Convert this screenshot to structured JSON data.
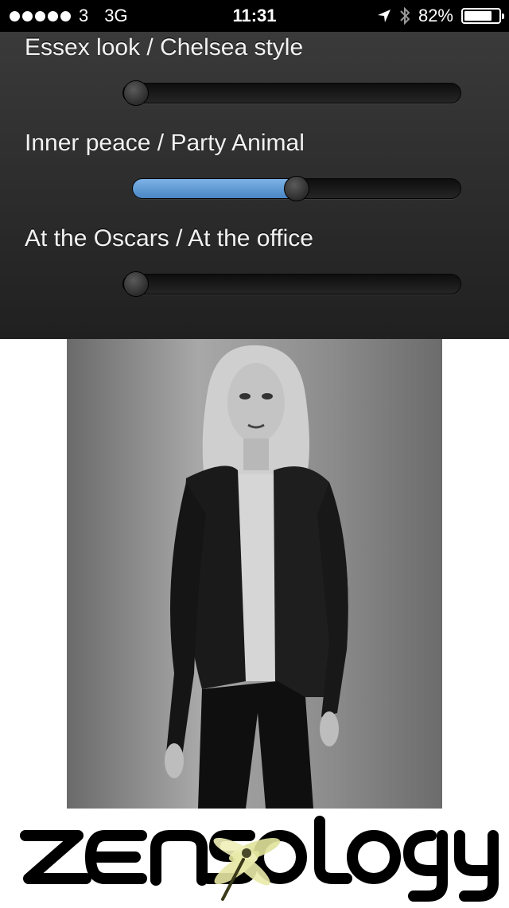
{
  "status_bar": {
    "carrier": "3",
    "network": "3G",
    "time": "11:31",
    "battery_percent": "82%",
    "battery_level": 0.82,
    "signal_dots": 5,
    "icons": [
      "location-arrow-icon",
      "bluetooth-icon",
      "battery-icon"
    ]
  },
  "sliders": [
    {
      "label": "Essex look / Chelsea style",
      "value": 0.0
    },
    {
      "label": "Inner peace / Party Animal",
      "value": 0.5
    },
    {
      "label": "At the Oscars / At the office",
      "value": 0.0
    }
  ],
  "accent_color": "#5b9ad6",
  "photo": {
    "subject": "fashion-photo"
  },
  "logo": {
    "text": "zensology"
  }
}
